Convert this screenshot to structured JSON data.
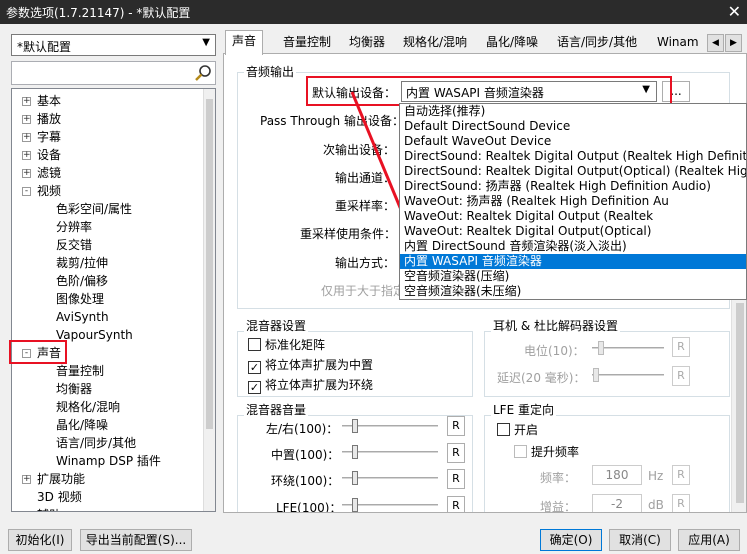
{
  "window": {
    "title": "参数选项(1.7.21147) - *默认配置",
    "close": "✕"
  },
  "sidebar": {
    "preset": "*默认配置",
    "search_placeholder": "",
    "tree": [
      {
        "label": "基本",
        "toggle": "+"
      },
      {
        "label": "播放",
        "toggle": "+"
      },
      {
        "label": "字幕",
        "toggle": "+"
      },
      {
        "label": "设备",
        "toggle": "+"
      },
      {
        "label": "滤镜",
        "toggle": "+"
      },
      {
        "label": "视频",
        "toggle": "-"
      },
      {
        "label": "色彩空间/属性"
      },
      {
        "label": "分辨率"
      },
      {
        "label": "反交错"
      },
      {
        "label": "裁剪/拉伸"
      },
      {
        "label": "色阶/偏移"
      },
      {
        "label": "图像处理"
      },
      {
        "label": "AviSynth"
      },
      {
        "label": "VapourSynth"
      },
      {
        "label": "声音",
        "toggle": "-"
      },
      {
        "label": "音量控制"
      },
      {
        "label": "均衡器"
      },
      {
        "label": "规格化/混响"
      },
      {
        "label": "晶化/降噪"
      },
      {
        "label": "语言/同步/其他"
      },
      {
        "label": "Winamp DSP 插件"
      },
      {
        "label": "扩展功能",
        "toggle": "+"
      },
      {
        "label": "3D 视频"
      },
      {
        "label": "辅助"
      }
    ]
  },
  "tabs": [
    "声音",
    "音量控制",
    "均衡器",
    "规格化/混响",
    "晶化/降噪",
    "语言/同步/其他",
    "Winam"
  ],
  "audio_output": {
    "group": "音频输出",
    "default_device_label": "默认输出设备：",
    "default_device_value": "内置 WASAPI 音频渲染器",
    "more": "...",
    "passthrough_label": "Pass Through 输出设备：",
    "secondary_label": "次输出设备：",
    "channels_label": "输出通道：",
    "resample_label": "重采样率：",
    "resample_cond_label": "重采样使用条件：",
    "output_mode_label": "输出方式：",
    "note": "仅用于大于指定"
  },
  "dropdown": {
    "options": [
      "自动选择(推荐)",
      "Default DirectSound Device",
      "Default WaveOut Device",
      "DirectSound: Realtek Digital Output (Realtek High Definition Audio)",
      "DirectSound: Realtek Digital Output(Optical) (Realtek High Definition Audio)",
      "DirectSound: 扬声器 (Realtek High Definition Audio)",
      "WaveOut: 扬声器 (Realtek High Definition Au",
      "WaveOut: Realtek Digital Output (Realtek",
      "WaveOut: Realtek Digital Output(Optical)",
      "内置 DirectSound 音频渲染器(淡入淡出)",
      "内置 WASAPI 音频渲染器",
      "空音频渲染器(压缩)",
      "空音频渲染器(未压缩)"
    ],
    "selected_index": 10
  },
  "mixer_settings": {
    "group": "混音器设置",
    "standard_matrix": "标准化矩阵",
    "stereo_center": "将立体声扩展为中置",
    "stereo_surround": "将立体声扩展为环绕"
  },
  "headphone": {
    "group": "耳机 & 杜比解码器设置",
    "position": "电位(10)：",
    "delay": "延迟(20 毫秒)："
  },
  "mixer_volume": {
    "group": "混音器音量",
    "left_right": "左/右(100)：",
    "center": "中置(100)：",
    "surround": "环绕(100)：",
    "lfe": "LFE(100)："
  },
  "lfe": {
    "group": "LFE 重定向",
    "enable": "开启",
    "boost": "提升频率",
    "freq_label": "频率：",
    "freq_value": "180",
    "freq_unit": "Hz",
    "gain_label": "增益：",
    "gain_value": "-2",
    "gain_unit": "dB"
  },
  "reset_label": "R",
  "buttons": {
    "init": "初始化(I)",
    "export": "导出当前配置(S)...",
    "ok": "确定(O)",
    "cancel": "取消(C)",
    "apply": "应用(A)"
  },
  "colors": {
    "highlight": "#e81123",
    "selection": "#0078d7"
  }
}
